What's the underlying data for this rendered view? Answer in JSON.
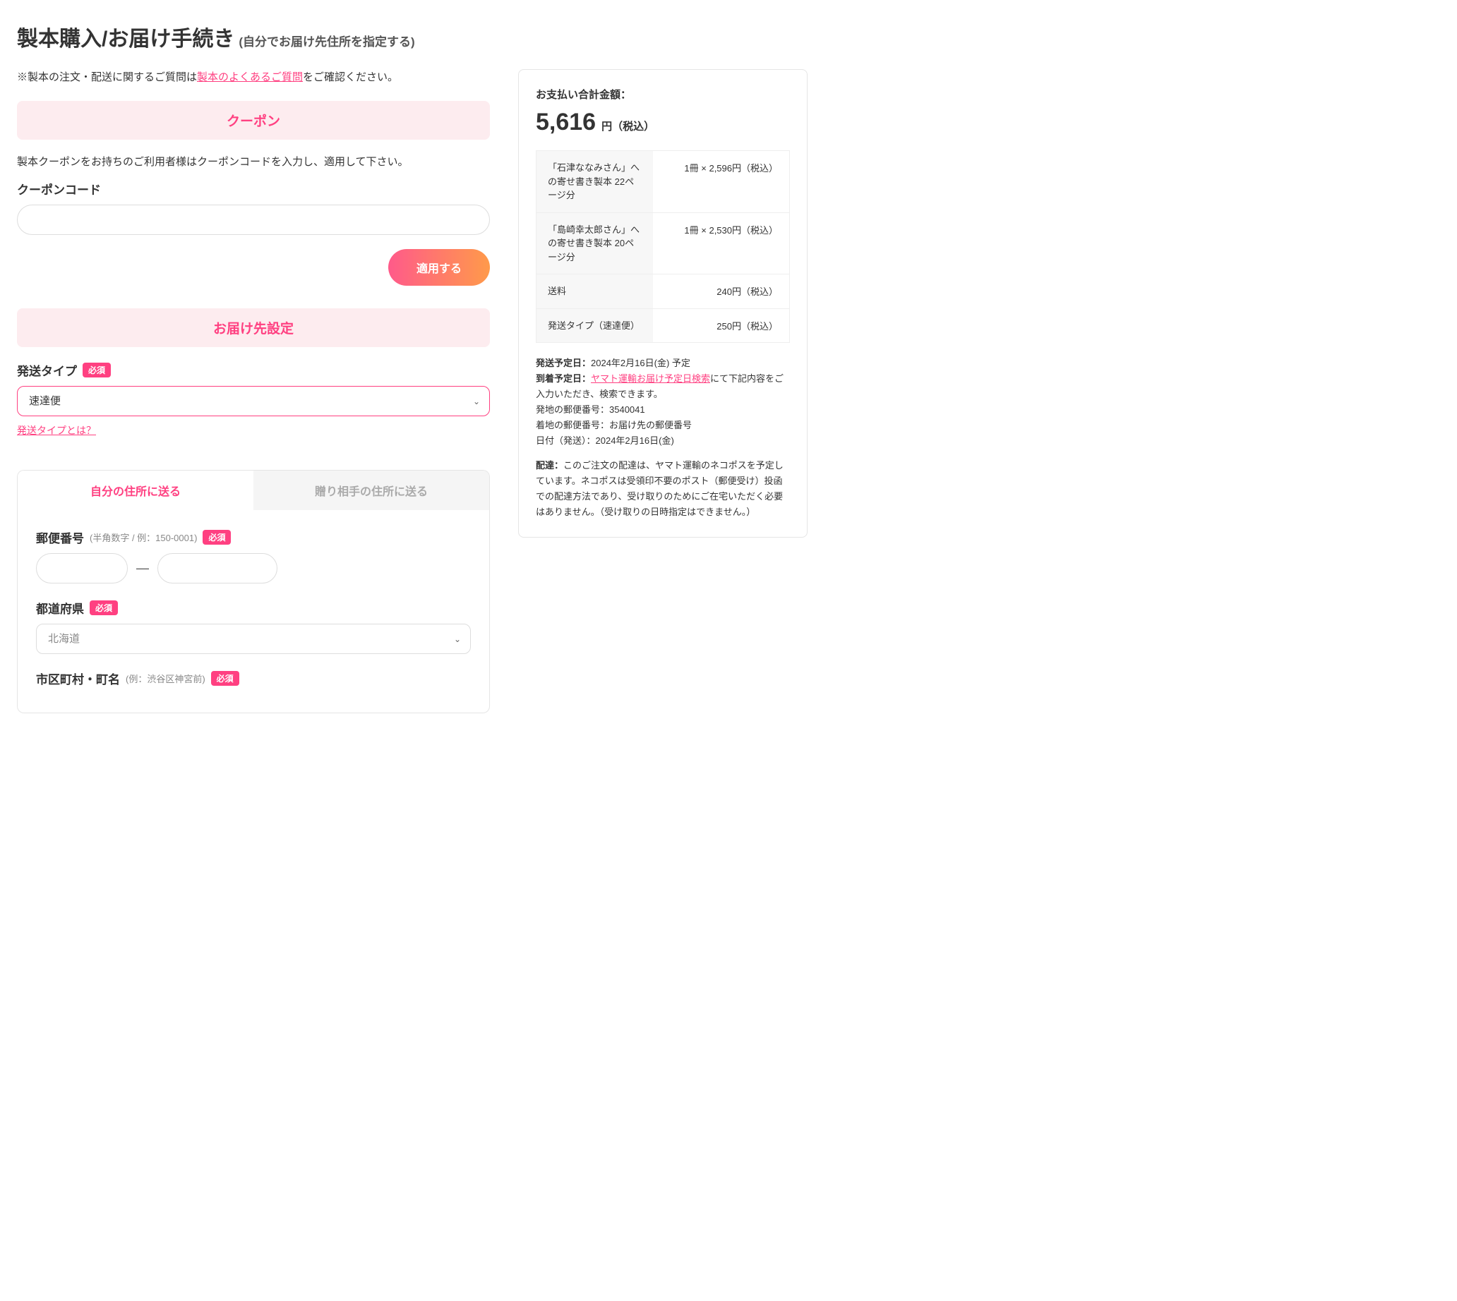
{
  "page": {
    "title": "製本購入/お届け手続き",
    "subtitle": "(自分でお届け先住所を指定する)"
  },
  "note": {
    "prefix": "※製本の注文・配送に関するご質問は",
    "link": "製本のよくあるご質問",
    "suffix": "をご確認ください。"
  },
  "coupon": {
    "header": "クーポン",
    "desc": "製本クーポンをお持ちのご利用者様はクーポンコードを入力し、適用して下さい。",
    "code_label": "クーポンコード",
    "apply": "適用する"
  },
  "delivery": {
    "header": "お届け先設定",
    "shipping_type_label": "発送タイプ",
    "required": "必須",
    "shipping_type_value": "速達便",
    "shipping_type_help": "発送タイプとは？",
    "tabs": {
      "self": "自分の住所に送る",
      "gift": "贈り相手の住所に送る"
    },
    "postal": {
      "label": "郵便番号",
      "hint": "(半角数字 / 例：150-0001)",
      "dash": "—"
    },
    "prefecture": {
      "label": "都道府県",
      "value": "北海道"
    },
    "city": {
      "label": "市区町村・町名",
      "hint": "(例：渋谷区神宮前)"
    }
  },
  "summary": {
    "title": "お支払い合計金額：",
    "amount": "5,616",
    "unit": "円（税込）",
    "items": [
      {
        "label": "「石津ななみさん」への寄せ書き製本 22ページ分",
        "value": "1冊 × 2,596円（税込）"
      },
      {
        "label": "「島崎幸太郎さん」への寄せ書き製本 20ページ分",
        "value": "1冊 × 2,530円（税込）"
      },
      {
        "label": "送料",
        "value": "240円（税込）"
      },
      {
        "label": "発送タイプ（速達便）",
        "value": "250円（税込）"
      }
    ],
    "ship_date": {
      "label": "発送予定日：",
      "value": "2024年2月16日(金) 予定"
    },
    "arrive_date": {
      "label": "到着予定日：",
      "link": "ヤマト運輸お届け予定日検索",
      "suffix": "にて下記内容をご入力いただき、検索できます。"
    },
    "origin_postal": "発地の郵便番号：3540041",
    "dest_postal": "着地の郵便番号：お届け先の郵便番号",
    "send_date": "日付（発送）：2024年2月16日(金)",
    "delivery_note": {
      "label": "配達：",
      "text": "このご注文の配達は、ヤマト運輸のネコポスを予定しています。ネコポスは受領印不要のポスト（郵便受け）投函での配達方法であり、受け取りのためにご在宅いただく必要はありません。（受け取りの日時指定はできません。）"
    }
  }
}
